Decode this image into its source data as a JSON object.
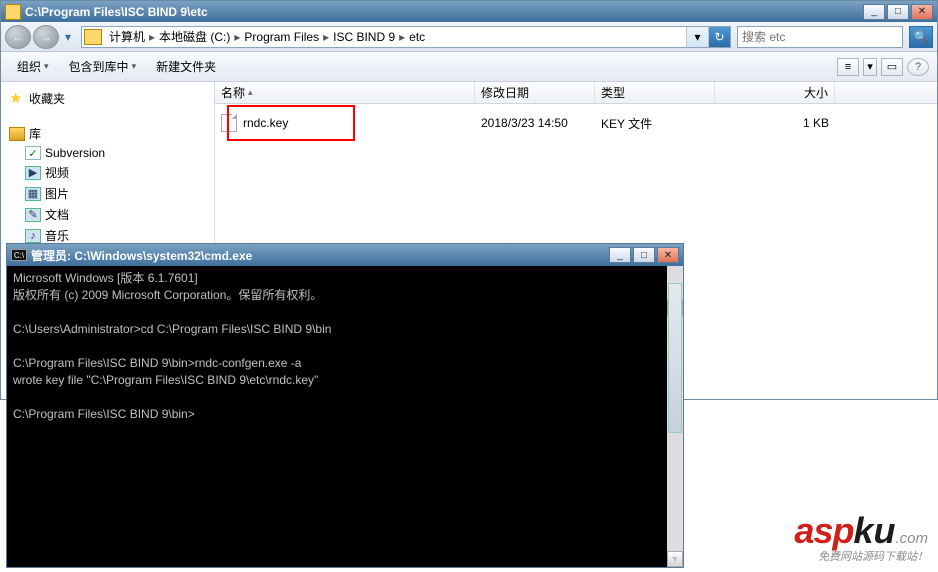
{
  "explorer": {
    "title": "C:\\Program Files\\ISC BIND 9\\etc",
    "win_min": "_",
    "win_max": "□",
    "win_close": "✕",
    "nav_back": "←",
    "nav_fwd": "→",
    "nav_dd": "▾",
    "breadcrumb": {
      "segs": [
        "计算机",
        "本地磁盘 (C:)",
        "Program Files",
        "ISC BIND 9",
        "etc"
      ],
      "sep": "▸",
      "refresh": "↻",
      "dd": "▾"
    },
    "search_placeholder": "搜索 etc",
    "search_icon": "🔍",
    "toolbar": {
      "organize": "组织",
      "include": "包含到库中",
      "newfolder": "新建文件夹",
      "sep": "▾",
      "view_icon": "≡",
      "view_dd": "▾",
      "preview": "▭",
      "help": "?"
    },
    "sidebar": {
      "favorites": "收藏夹",
      "library": "库",
      "items": [
        {
          "label": "Subversion"
        },
        {
          "label": "视频"
        },
        {
          "label": "图片"
        },
        {
          "label": "文档"
        },
        {
          "label": "音乐"
        }
      ]
    },
    "columns": {
      "name": "名称",
      "date": "修改日期",
      "type": "类型",
      "size": "大小",
      "sort": "▴"
    },
    "files": [
      {
        "name": "rndc.key",
        "date": "2018/3/23 14:50",
        "type": "KEY 文件",
        "size": "1 KB"
      }
    ]
  },
  "cmd": {
    "title": "管理员: C:\\Windows\\system32\\cmd.exe",
    "ci": "C:\\",
    "content": "Microsoft Windows [版本 6.1.7601]\n版权所有 (c) 2009 Microsoft Corporation。保留所有权利。\n\nC:\\Users\\Administrator>cd C:\\Program Files\\ISC BIND 9\\bin\n\nC:\\Program Files\\ISC BIND 9\\bin>rndc-confgen.exe -a\nwrote key file \"C:\\Program Files\\ISC BIND 9\\etc\\rndc.key\"\n\nC:\\Program Files\\ISC BIND 9\\bin>",
    "sb_up": "▲",
    "sb_dn": "▼"
  },
  "watermark": {
    "asp": "asp",
    "ku": "ku",
    "com": ".com",
    "sub": "免费网站源码下载站！"
  }
}
